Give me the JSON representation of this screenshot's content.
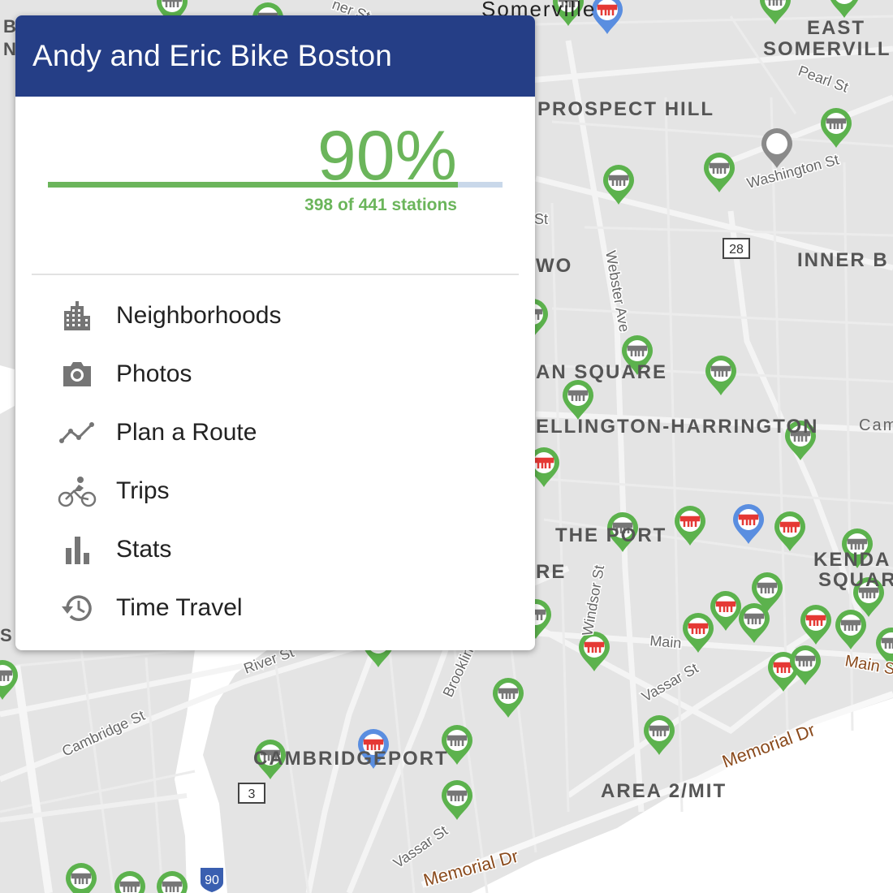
{
  "panel": {
    "title": "Andy and Eric Bike Boston",
    "progress": {
      "percent_label": "90%",
      "fraction": 0.9025,
      "count_label": "398 of 441 stations",
      "color": "#6bb55b",
      "track_color": "#c9d8ea"
    },
    "header_color": "#253e86",
    "menu": [
      {
        "label": "Neighborhoods",
        "icon": "city-icon"
      },
      {
        "label": "Photos",
        "icon": "camera-icon"
      },
      {
        "label": "Plan a Route",
        "icon": "route-icon"
      },
      {
        "label": "Trips",
        "icon": "bike-icon"
      },
      {
        "label": "Stats",
        "icon": "bar-chart-icon"
      },
      {
        "label": "Time Travel",
        "icon": "history-icon"
      }
    ]
  },
  "map": {
    "area_labels": [
      "Somerville",
      "EAST",
      "SOMERVILL",
      "PROSPECT HILL",
      "INNER B",
      "WO",
      "AN SQUARE",
      "ELLINGTON-HARRINGTON",
      "Cam",
      "THE PORT",
      "RE",
      "KENDA",
      "SQUAR",
      "CAMBRIDGEPORT",
      "AREA 2/MIT",
      "B",
      "N",
      "S"
    ],
    "street_labels": [
      "Pearl St",
      "Washington St",
      "St",
      "Webster Ave",
      "Windsor St",
      "Main",
      "Main St",
      "Vassar St",
      "Brooklin",
      "River St",
      "Cambridge St",
      "Memorial Dr",
      "Memorial Dr",
      "Vassar St",
      "Memorial Dr",
      "ner St"
    ],
    "route_shields": [
      "28",
      "3",
      "90"
    ],
    "marker_colors": {
      "visited": "#5cb24d",
      "unvisited": "#e53935",
      "highlighted": "#5a8ee0",
      "other": "#8a8a8a"
    }
  }
}
